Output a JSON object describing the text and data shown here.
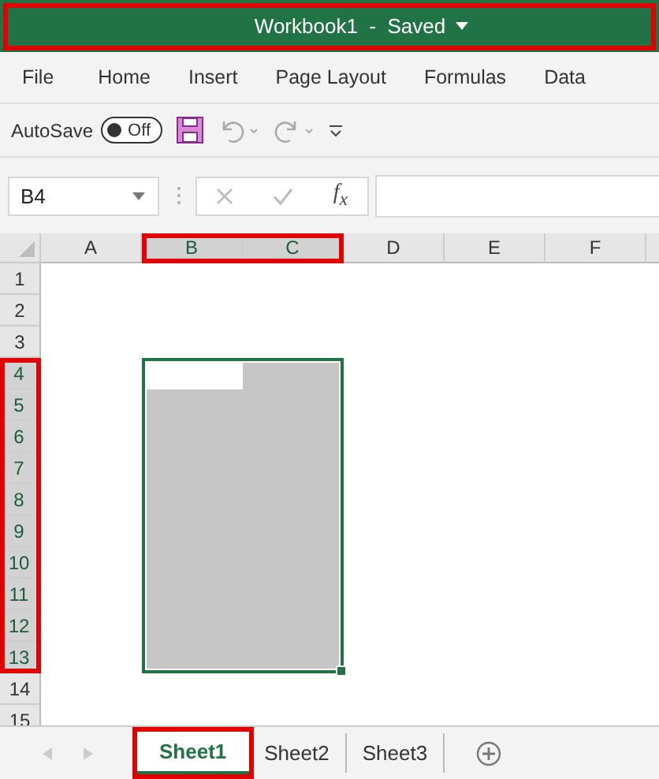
{
  "title_bar": {
    "title": "Workbook1  -  Saved",
    "annotated": true
  },
  "ribbon_tabs": [
    {
      "label": "File"
    },
    {
      "label": "Home"
    },
    {
      "label": "Insert"
    },
    {
      "label": "Page Layout"
    },
    {
      "label": "Formulas"
    },
    {
      "label": "Data"
    }
  ],
  "quick_access": {
    "autosave_label": "AutoSave",
    "toggle_label": "Off",
    "autosave_on": false
  },
  "formula_bar": {
    "name_box": "B4",
    "fx_label": "f$_{x}$"
  },
  "columns": [
    {
      "label": "A",
      "selected": false,
      "annotated": false
    },
    {
      "label": "B",
      "selected": true,
      "annotated": true
    },
    {
      "label": "C",
      "selected": true,
      "annotated": true
    },
    {
      "label": "D",
      "selected": false,
      "annotated": false
    },
    {
      "label": "E",
      "selected": false,
      "annotated": false
    },
    {
      "label": "F",
      "selected": false,
      "annotated": false
    }
  ],
  "rows": [
    {
      "label": "1",
      "selected": false,
      "annotated": false
    },
    {
      "label": "2",
      "selected": false,
      "annotated": false
    },
    {
      "label": "3",
      "selected": false,
      "annotated": false
    },
    {
      "label": "4",
      "selected": true,
      "annotated": true
    },
    {
      "label": "5",
      "selected": true,
      "annotated": true
    },
    {
      "label": "6",
      "selected": true,
      "annotated": true
    },
    {
      "label": "7",
      "selected": true,
      "annotated": true
    },
    {
      "label": "8",
      "selected": true,
      "annotated": true
    },
    {
      "label": "9",
      "selected": true,
      "annotated": true
    },
    {
      "label": "10",
      "selected": true,
      "annotated": true
    },
    {
      "label": "11",
      "selected": true,
      "annotated": true
    },
    {
      "label": "12",
      "selected": true,
      "annotated": true
    },
    {
      "label": "13",
      "selected": true,
      "annotated": true
    },
    {
      "label": "14",
      "selected": false,
      "annotated": false
    },
    {
      "label": "15",
      "selected": false,
      "annotated": false
    }
  ],
  "sheet_tabs": [
    {
      "label": "Sheet1",
      "selected": true,
      "annotated": true
    },
    {
      "label": "Sheet2",
      "selected": false,
      "annotated": false
    },
    {
      "label": "Sheet3",
      "selected": false,
      "annotated": false
    }
  ]
}
